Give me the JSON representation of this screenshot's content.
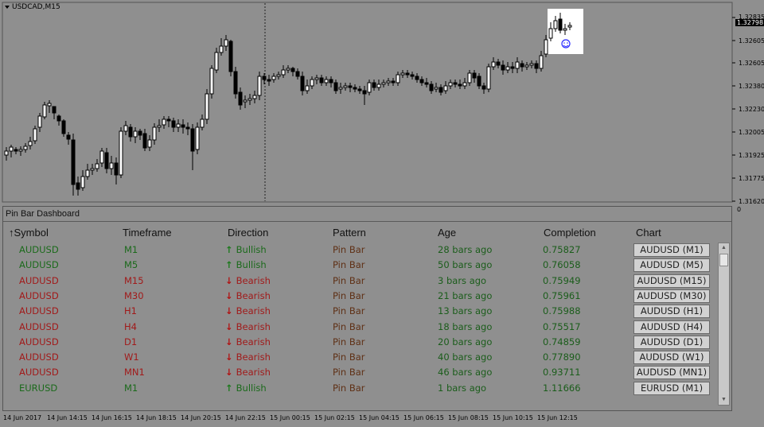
{
  "chart": {
    "symbol_label": "USDCAD,M15",
    "price_ticks": [
      "1.32835",
      "1.32605",
      "1.32380",
      "1.32230",
      "1.32005",
      "1.31925",
      "1.31775",
      "1.31620"
    ],
    "current_price": "1.32798",
    "indicator_zero": "0"
  },
  "dashboard": {
    "title": "Pin Bar Dashboard",
    "columns": [
      "↑Symbol",
      "Timeframe",
      "Direction",
      "Pattern",
      "Age",
      "Completion",
      "Chart"
    ],
    "rows": [
      {
        "symbol": "AUDUSD",
        "timeframe": "M1",
        "direction": "Bullish",
        "pattern": "Pin Bar",
        "age": "28 bars ago",
        "completion": "0.75827",
        "chart": "AUDUSD (M1)"
      },
      {
        "symbol": "AUDUSD",
        "timeframe": "M5",
        "direction": "Bullish",
        "pattern": "Pin Bar",
        "age": "50 bars ago",
        "completion": "0.76058",
        "chart": "AUDUSD (M5)"
      },
      {
        "symbol": "AUDUSD",
        "timeframe": "M15",
        "direction": "Bearish",
        "pattern": "Pin Bar",
        "age": "3 bars ago",
        "completion": "0.75949",
        "chart": "AUDUSD (M15)"
      },
      {
        "symbol": "AUDUSD",
        "timeframe": "M30",
        "direction": "Bearish",
        "pattern": "Pin Bar",
        "age": "21 bars ago",
        "completion": "0.75961",
        "chart": "AUDUSD (M30)"
      },
      {
        "symbol": "AUDUSD",
        "timeframe": "H1",
        "direction": "Bearish",
        "pattern": "Pin Bar",
        "age": "13 bars ago",
        "completion": "0.75988",
        "chart": "AUDUSD (H1)"
      },
      {
        "symbol": "AUDUSD",
        "timeframe": "H4",
        "direction": "Bearish",
        "pattern": "Pin Bar",
        "age": "18 bars ago",
        "completion": "0.75517",
        "chart": "AUDUSD (H4)"
      },
      {
        "symbol": "AUDUSD",
        "timeframe": "D1",
        "direction": "Bearish",
        "pattern": "Pin Bar",
        "age": "20 bars ago",
        "completion": "0.74859",
        "chart": "AUDUSD (D1)"
      },
      {
        "symbol": "AUDUSD",
        "timeframe": "W1",
        "direction": "Bearish",
        "pattern": "Pin Bar",
        "age": "40 bars ago",
        "completion": "0.77890",
        "chart": "AUDUSD (W1)"
      },
      {
        "symbol": "AUDUSD",
        "timeframe": "MN1",
        "direction": "Bearish",
        "pattern": "Pin Bar",
        "age": "46 bars ago",
        "completion": "0.93711",
        "chart": "AUDUSD (MN1)"
      },
      {
        "symbol": "EURUSD",
        "timeframe": "M1",
        "direction": "Bullish",
        "pattern": "Pin Bar",
        "age": "1 bars ago",
        "completion": "1.11666",
        "chart": "EURUSD (M1)"
      }
    ]
  },
  "time_axis": [
    "14 Jun 2017",
    "14 Jun 14:15",
    "14 Jun 16:15",
    "14 Jun 18:15",
    "14 Jun 20:15",
    "14 Jun 22:15",
    "15 Jun 00:15",
    "15 Jun 02:15",
    "15 Jun 04:15",
    "15 Jun 06:15",
    "15 Jun 08:15",
    "15 Jun 10:15",
    "15 Jun 12:15"
  ],
  "colors": {
    "background": "#8f8f8f",
    "bullish": "#1b6a1b",
    "bearish": "#a11a1a",
    "pattern": "#5f3015"
  },
  "icons": {
    "sort": "sort-up-arrow-icon",
    "bull": "arrow-up-icon",
    "bear": "arrow-down-icon",
    "smiley": "smiley-icon"
  }
}
